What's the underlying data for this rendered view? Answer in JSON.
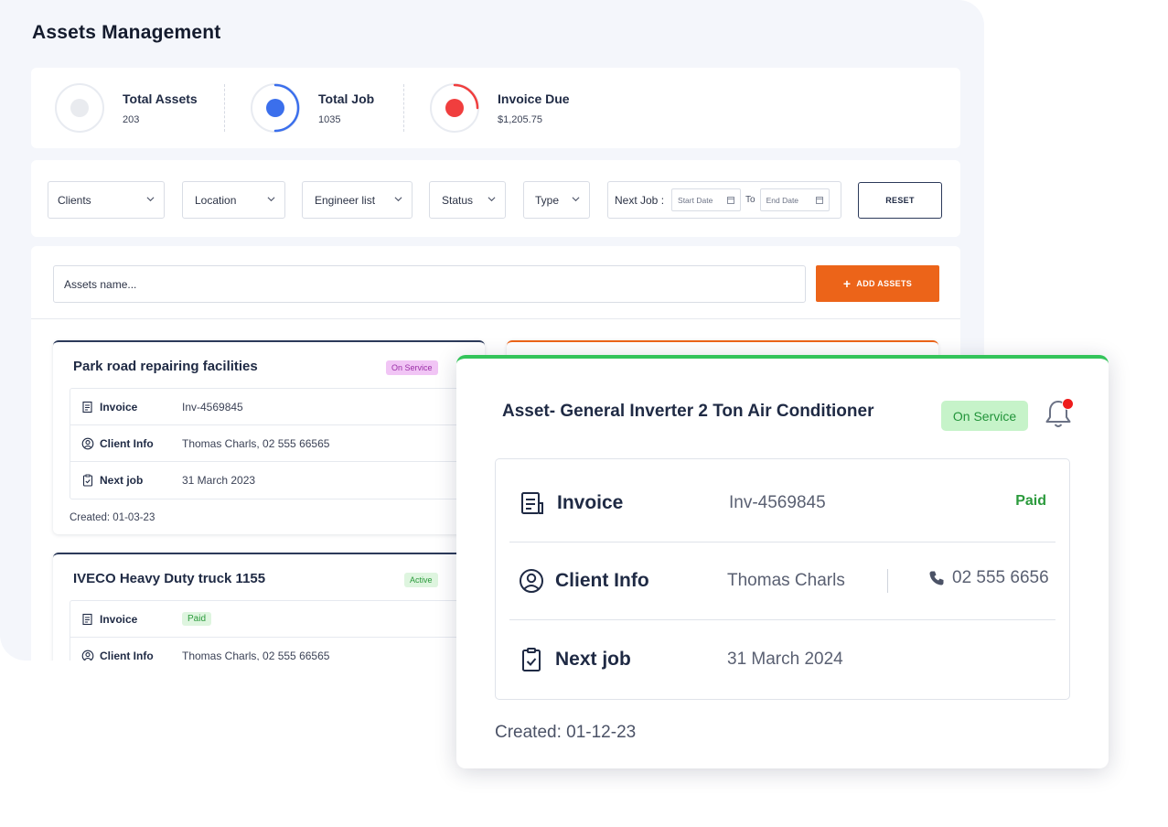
{
  "page": {
    "title": "Assets Management"
  },
  "stats": [
    {
      "label": "Total Assets",
      "value": "203",
      "color": "#e9ebef"
    },
    {
      "label": "Total Job",
      "value": "1035",
      "color": "#3b6fec"
    },
    {
      "label": "Invoice Due",
      "value": "$1,205.75",
      "color": "#f03e3e"
    }
  ],
  "filters": {
    "clients": "Clients",
    "location": "Location",
    "engineer": "Engineer list",
    "status": "Status",
    "type": "Type",
    "next_job_label": "Next Job :",
    "start_placeholder": "Start Date",
    "to_label": "To",
    "end_placeholder": "End Date",
    "reset": "RESET"
  },
  "search": {
    "placeholder": "Assets name...",
    "add_label": "ADD ASSETS"
  },
  "cards": [
    {
      "title": "Park road repairing facilities",
      "badge": "On Service",
      "rows": [
        {
          "label": "Invoice",
          "value": "Inv-4569845"
        },
        {
          "label": "Client Info",
          "value": "Thomas Charls, 02 555 66565"
        },
        {
          "label": "Next job",
          "value": "31 March 2023"
        }
      ],
      "created": "Created: 01-03-23"
    },
    {
      "title": "IVECO Heavy Duty truck 1155",
      "badge": "Active",
      "rows": [
        {
          "label": "Invoice",
          "value": "Paid"
        },
        {
          "label": "Client Info",
          "value": "Thomas Charls, 02 555 66565"
        }
      ]
    }
  ],
  "detail": {
    "title": "Asset- General Inverter 2 Ton Air Conditioner",
    "badge": "On Service",
    "invoice_label": "Invoice",
    "invoice_value": "Inv-4569845",
    "invoice_status": "Paid",
    "client_label": "Client Info",
    "client_name": "Thomas Charls",
    "client_phone": "02 555 6656",
    "nextjob_label": "Next job",
    "nextjob_value": "31 March 2024",
    "created": "Created: 01-12-23"
  },
  "colors": {
    "accent": "#ec6419",
    "success": "#33c45a",
    "navy": "#1f2a44"
  }
}
